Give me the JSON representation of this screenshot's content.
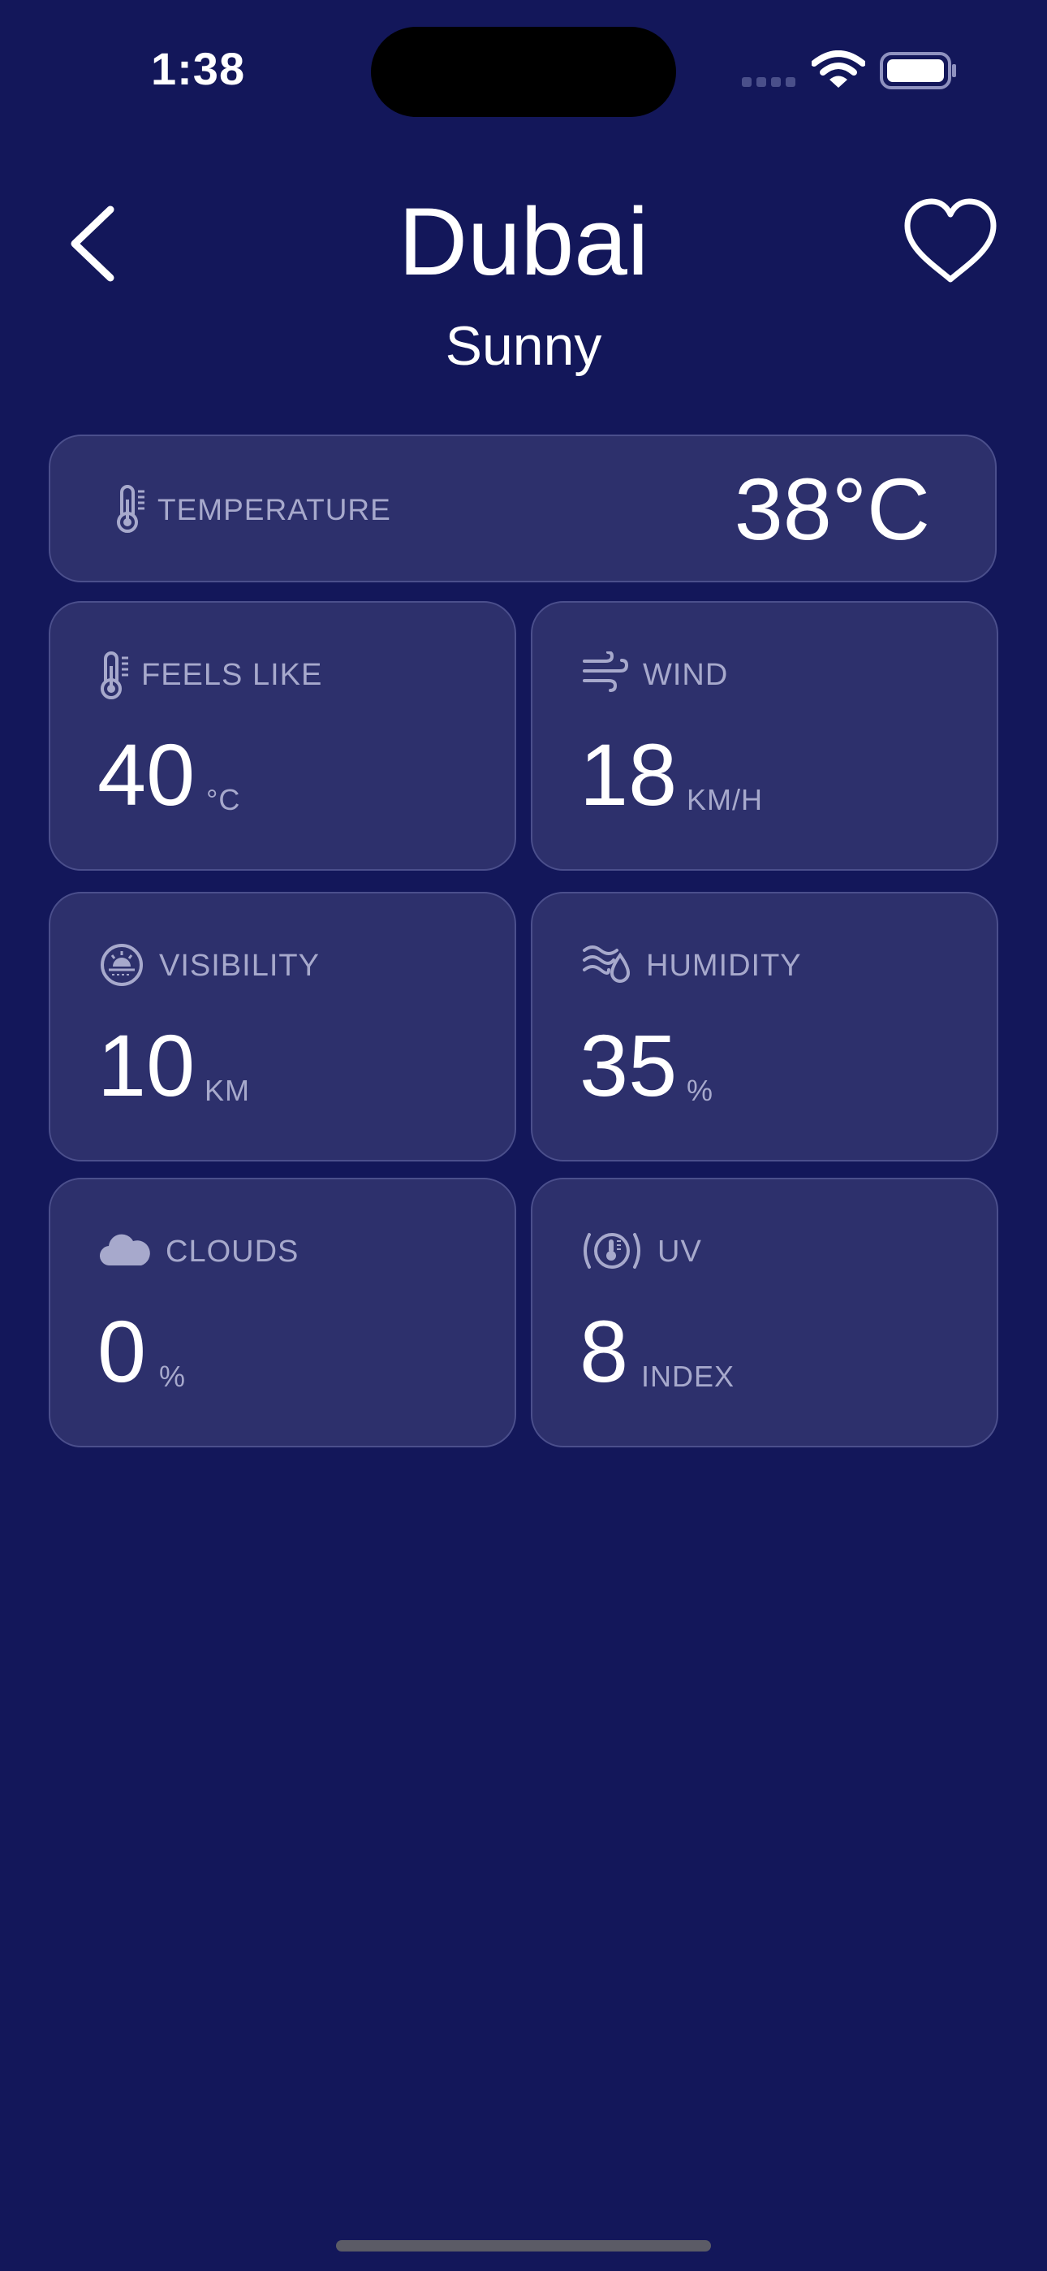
{
  "status_bar": {
    "time": "1:38"
  },
  "header": {
    "city": "Dubai",
    "condition": "Sunny"
  },
  "temperature": {
    "label": "TEMPERATURE",
    "value": "38°C",
    "icon": "thermometer-icon"
  },
  "tiles": [
    {
      "label": "FEELS LIKE",
      "value": "40",
      "unit": "°C",
      "icon": "thermometer-icon"
    },
    {
      "label": "WIND",
      "value": "18",
      "unit": "KM/H",
      "icon": "wind-icon"
    },
    {
      "label": "VISIBILITY",
      "value": "10",
      "unit": "KM",
      "icon": "visibility-icon"
    },
    {
      "label": "HUMIDITY",
      "value": "35",
      "unit": "%",
      "icon": "humidity-icon"
    },
    {
      "label": "CLOUDS",
      "value": "0",
      "unit": "%",
      "icon": "cloud-icon"
    },
    {
      "label": "UV",
      "value": "8",
      "unit": "INDEX",
      "icon": "uv-icon"
    }
  ],
  "colors": {
    "background": "#13175a",
    "card": "#2d306c",
    "card_border": "#4b4f8c",
    "muted_text": "#a7a9cc"
  }
}
